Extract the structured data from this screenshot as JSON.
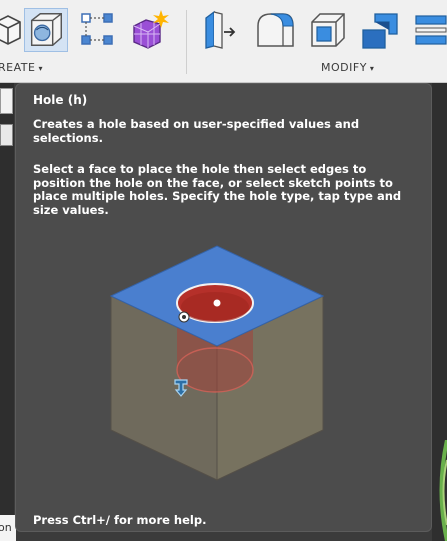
{
  "toolbar": {
    "create_label_visible": "REATE",
    "modify_label": "MODIFY",
    "caret": "▾",
    "create_icons": [
      "box-icon",
      "hole-icon",
      "rectangular-pattern-icon",
      "create-form-icon"
    ],
    "modify_icons": [
      "press-pull-icon",
      "fillet-icon",
      "shell-icon",
      "combine-icon",
      "offset-face-icon"
    ]
  },
  "tooltip": {
    "title": "Hole (h)",
    "description": "Creates a hole based on user-specified values and selections.",
    "instructions": "Select a face to place the hole then select edges to position the hole on the face, or select sketch points to place multiple holes. Specify the hole type, tap type and size values.",
    "footer": "Press Ctrl+/ for more help."
  },
  "left_panel": {
    "bottom_text": "on"
  },
  "colors": {
    "tooltip_bg": "#4c4c4c",
    "face_blue": "#4a7fcf",
    "hole_red": "#b5302a",
    "cube_side": "#6f6a5c",
    "toolbar_bg": "#f0f0f0"
  }
}
